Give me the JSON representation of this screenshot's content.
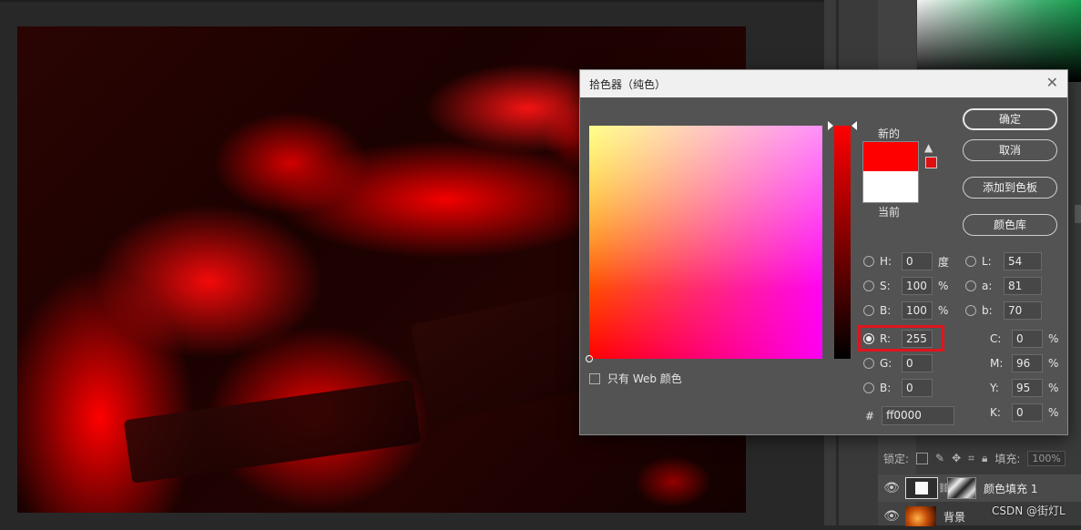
{
  "dialog": {
    "title": "拾色器（纯色）",
    "labels": {
      "new": "新的",
      "current": "当前"
    },
    "buttons": {
      "ok": "确定",
      "cancel": "取消",
      "add_to_swatches": "添加到色板",
      "color_libraries": "颜色库"
    },
    "new_color": "#ff0000",
    "current_color": "#ffffff",
    "web_only_label": "只有 Web 颜色",
    "web_only_checked": false,
    "selected_channel": "R",
    "hsb": [
      {
        "label": "H:",
        "value": "0",
        "unit": "度"
      },
      {
        "label": "S:",
        "value": "100",
        "unit": "%"
      },
      {
        "label": "B:",
        "value": "100",
        "unit": "%"
      }
    ],
    "rgb": [
      {
        "label": "R:",
        "value": "255"
      },
      {
        "label": "G:",
        "value": "0"
      },
      {
        "label": "B:",
        "value": "0"
      }
    ],
    "lab": [
      {
        "label": "L:",
        "value": "54"
      },
      {
        "label": "a:",
        "value": "81"
      },
      {
        "label": "b:",
        "value": "70"
      }
    ],
    "cmyk": [
      {
        "label": "C:",
        "value": "0",
        "unit": "%"
      },
      {
        "label": "M:",
        "value": "96",
        "unit": "%"
      },
      {
        "label": "Y:",
        "value": "95",
        "unit": "%"
      },
      {
        "label": "K:",
        "value": "0",
        "unit": "%"
      }
    ],
    "hex_label": "#",
    "hex_value": "ff0000"
  },
  "layers": {
    "lock_label": "锁定:",
    "fill_label": "填充:",
    "fill_value": "100%",
    "items": [
      {
        "name": "颜色填充 1",
        "visible": true,
        "selected": true
      },
      {
        "name": "背景",
        "visible": true,
        "selected": false
      }
    ]
  },
  "watermark": "CSDN @街灯L",
  "icons": [
    "close-icon",
    "warning-icon",
    "eye-icon",
    "lock-icon",
    "brush-icon",
    "move-icon",
    "crop-icon",
    "padlock-icon",
    "link-icon"
  ]
}
